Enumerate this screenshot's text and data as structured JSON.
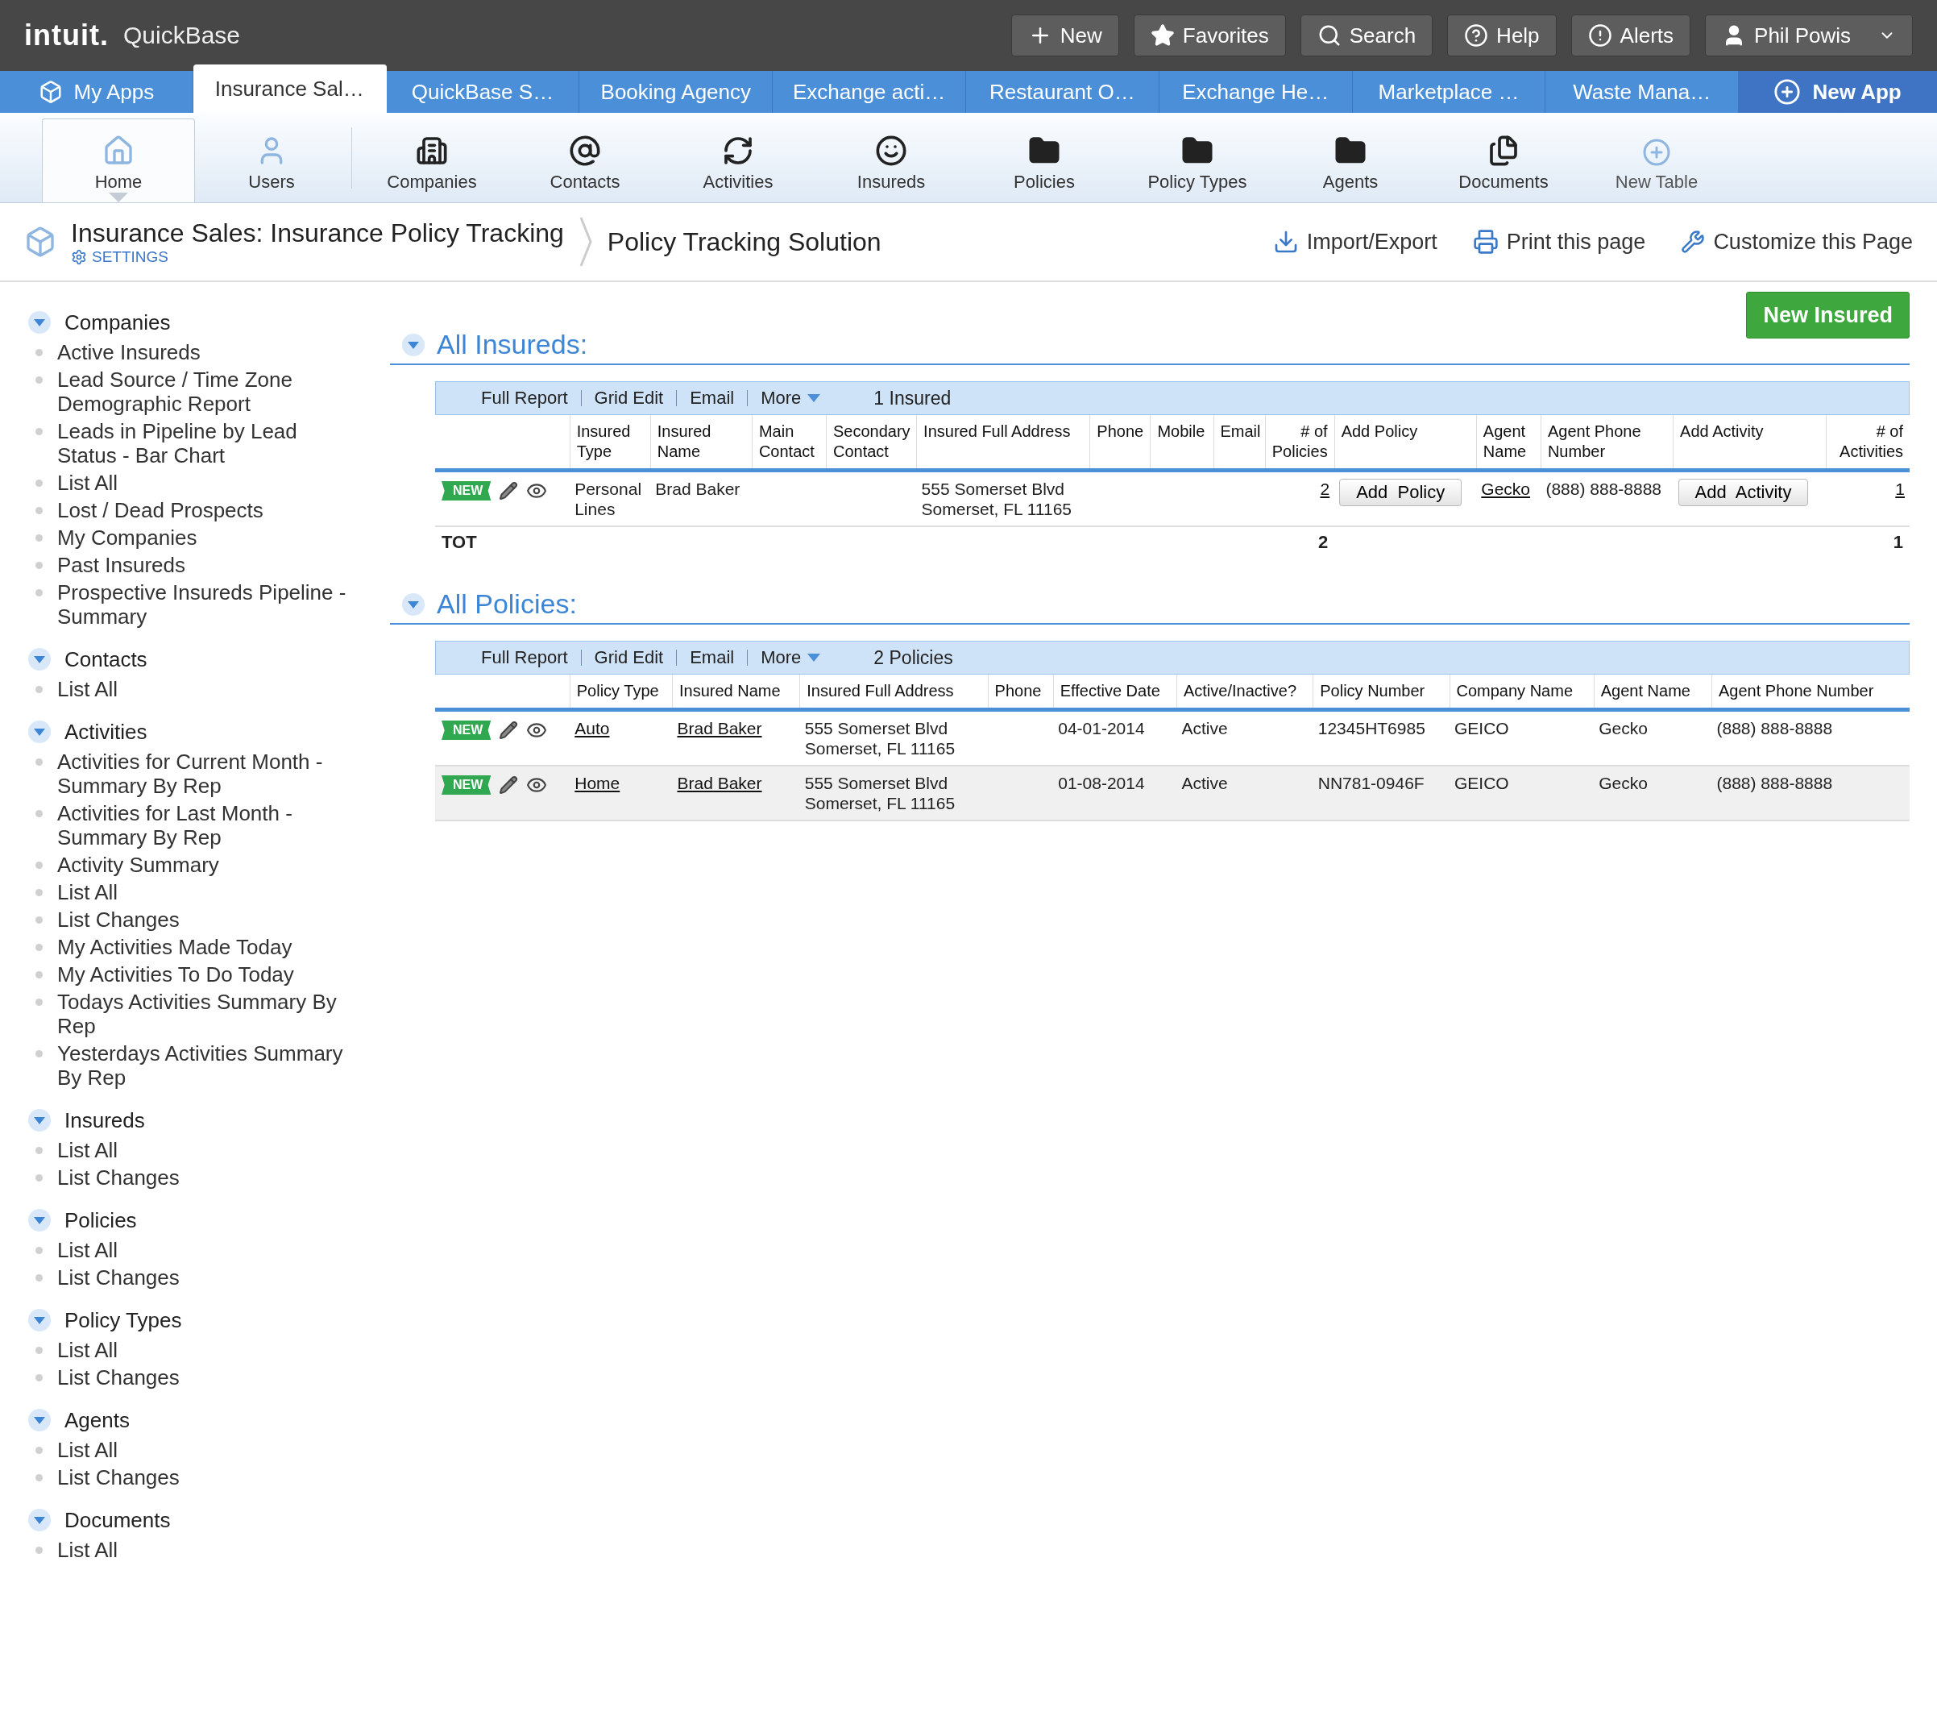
{
  "brand": {
    "logo": "intuit.",
    "product": "QuickBase"
  },
  "top_buttons": [
    {
      "label": "New",
      "kind": "new"
    },
    {
      "label": "Favorites",
      "kind": "favorites"
    },
    {
      "label": "Search",
      "kind": "search"
    },
    {
      "label": "Help",
      "kind": "help"
    },
    {
      "label": "Alerts",
      "kind": "alerts"
    },
    {
      "label": "Phil Powis",
      "kind": "user"
    }
  ],
  "app_tabs": [
    {
      "label": "My Apps",
      "kind": "home",
      "selected": false
    },
    {
      "label": "Insurance Sal…",
      "kind": "app",
      "selected": true
    },
    {
      "label": "QuickBase S…",
      "kind": "app",
      "selected": false
    },
    {
      "label": "Booking Agency",
      "kind": "app",
      "selected": false
    },
    {
      "label": "Exchange acti…",
      "kind": "app",
      "selected": false
    },
    {
      "label": "Restaurant O…",
      "kind": "app",
      "selected": false
    },
    {
      "label": "Exchange He…",
      "kind": "app",
      "selected": false
    },
    {
      "label": "Marketplace …",
      "kind": "app",
      "selected": false
    },
    {
      "label": "Waste Mana…",
      "kind": "app",
      "selected": false
    },
    {
      "label": "New App",
      "kind": "new",
      "selected": false
    }
  ],
  "toolbar": [
    {
      "label": "Home",
      "kind": "home",
      "selected": true
    },
    {
      "label": "Users",
      "kind": "users",
      "selected": false
    },
    {
      "label": "Companies",
      "kind": "companies",
      "selected": false
    },
    {
      "label": "Contacts",
      "kind": "contacts",
      "selected": false
    },
    {
      "label": "Activities",
      "kind": "activities",
      "selected": false
    },
    {
      "label": "Insureds",
      "kind": "insureds",
      "selected": false
    },
    {
      "label": "Policies",
      "kind": "folder",
      "selected": false
    },
    {
      "label": "Policy Types",
      "kind": "folder",
      "selected": false
    },
    {
      "label": "Agents",
      "kind": "folder",
      "selected": false
    },
    {
      "label": "Documents",
      "kind": "documents",
      "selected": false
    },
    {
      "label": "New Table",
      "kind": "new",
      "selected": false
    }
  ],
  "breadcrumb": {
    "app": "Insurance Sales: Insurance Policy Tracking",
    "settings": "SETTINGS",
    "page": "Policy Tracking Solution"
  },
  "page_actions": [
    {
      "label": "Import/Export",
      "kind": "import"
    },
    {
      "label": "Print this page",
      "kind": "print"
    },
    {
      "label": "Customize this Page",
      "kind": "customize"
    }
  ],
  "new_button": "New Insured",
  "sidebar": [
    {
      "title": "Companies",
      "expanded": true,
      "items": [
        "Active Insureds",
        "Lead Source / Time Zone Demographic Report",
        "Leads in Pipeline by Lead Status - Bar Chart",
        "List All",
        "Lost / Dead Prospects",
        "My Companies",
        "Past Insureds",
        "Prospective Insureds Pipeline - Summary"
      ]
    },
    {
      "title": "Contacts",
      "expanded": true,
      "items": [
        "List All"
      ]
    },
    {
      "title": "Activities",
      "expanded": true,
      "items": [
        "Activities for Current Month - Summary By Rep",
        "Activities for Last Month - Summary By Rep",
        "Activity Summary",
        "List All",
        "List Changes",
        "My Activities Made Today",
        "My Activities To Do Today",
        "Todays Activities Summary By Rep",
        "Yesterdays Activities Summary By Rep"
      ]
    },
    {
      "title": "Insureds",
      "expanded": true,
      "items": [
        "List All",
        "List Changes"
      ]
    },
    {
      "title": "Policies",
      "expanded": true,
      "items": [
        "List All",
        "List Changes"
      ]
    },
    {
      "title": "Policy Types",
      "expanded": true,
      "items": [
        "List All",
        "List Changes"
      ]
    },
    {
      "title": "Agents",
      "expanded": true,
      "items": [
        "List All",
        "List Changes"
      ]
    },
    {
      "title": "Documents",
      "expanded": true,
      "items": [
        "List All"
      ]
    }
  ],
  "reports": [
    {
      "title": "All Insureds:",
      "expanded": true,
      "actions": [
        "Full Report",
        "Grid Edit",
        "Email",
        "More"
      ],
      "count": "1 Insured",
      "columns": [
        {
          "label": "Insured Type",
          "numeric": false
        },
        {
          "label": "Insured Name",
          "numeric": false
        },
        {
          "label": "Main Contact",
          "numeric": false
        },
        {
          "label": "Secondary Contact",
          "numeric": false
        },
        {
          "label": "Insured Full Address",
          "numeric": false
        },
        {
          "label": "Phone",
          "numeric": false
        },
        {
          "label": "Mobile",
          "numeric": false
        },
        {
          "label": "Email",
          "numeric": false
        },
        {
          "label": "# of Policies",
          "numeric": true
        },
        {
          "label": "Add Policy",
          "numeric": false
        },
        {
          "label": "Agent Name",
          "numeric": false
        },
        {
          "label": "Agent Phone Number",
          "numeric": false
        },
        {
          "label": "Add Activity",
          "numeric": false
        },
        {
          "label": "# of Activities",
          "numeric": true
        }
      ],
      "rows": [
        {
          "badge": "NEW",
          "cells": [
            {
              "text": "Personal Lines",
              "kind": "text"
            },
            {
              "text": "Brad Baker",
              "kind": "text"
            },
            null,
            null,
            {
              "text": "555 Somerset Blvd\nSomerset, FL 11165",
              "kind": "text"
            },
            null,
            null,
            null,
            {
              "text": "2",
              "kind": "link"
            },
            {
              "text": "Add  Policy",
              "kind": "button"
            },
            {
              "text": "Gecko",
              "kind": "link"
            },
            {
              "text": "(888) 888-8888",
              "kind": "text"
            },
            {
              "text": "Add  Activity",
              "kind": "button"
            },
            {
              "text": "1",
              "kind": "link"
            }
          ]
        }
      ],
      "total": {
        "label": "TOT",
        "cells": [
          null,
          null,
          null,
          null,
          null,
          null,
          null,
          null,
          "2",
          null,
          null,
          null,
          null,
          "1"
        ]
      }
    },
    {
      "title": "All Policies:",
      "expanded": true,
      "actions": [
        "Full Report",
        "Grid Edit",
        "Email",
        "More"
      ],
      "count": "2 Policies",
      "columns": [
        {
          "label": "Policy Type",
          "numeric": false
        },
        {
          "label": "Insured Name",
          "numeric": false
        },
        {
          "label": "Insured Full Address",
          "numeric": false
        },
        {
          "label": "Phone",
          "numeric": false
        },
        {
          "label": "Effective Date",
          "numeric": false
        },
        {
          "label": "Active/Inactive?",
          "numeric": false
        },
        {
          "label": "Policy Number",
          "numeric": false
        },
        {
          "label": "Company Name",
          "numeric": false
        },
        {
          "label": "Agent Name",
          "numeric": false
        },
        {
          "label": "Agent Phone Number",
          "numeric": false
        }
      ],
      "rows": [
        {
          "badge": "NEW",
          "cells": [
            {
              "text": "Auto",
              "kind": "link"
            },
            {
              "text": "Brad Baker",
              "kind": "link"
            },
            {
              "text": "555 Somerset Blvd\nSomerset, FL 11165",
              "kind": "text"
            },
            null,
            {
              "text": "04-01-2014",
              "kind": "text"
            },
            {
              "text": "Active",
              "kind": "text"
            },
            {
              "text": "12345HT6985",
              "kind": "text"
            },
            {
              "text": "GEICO",
              "kind": "text"
            },
            {
              "text": "Gecko",
              "kind": "text"
            },
            {
              "text": "(888) 888-8888",
              "kind": "text"
            }
          ]
        },
        {
          "badge": "NEW",
          "cells": [
            {
              "text": "Home",
              "kind": "link"
            },
            {
              "text": "Brad Baker",
              "kind": "link"
            },
            {
              "text": "555 Somerset Blvd\nSomerset, FL 11165",
              "kind": "text"
            },
            null,
            {
              "text": "01-08-2014",
              "kind": "text"
            },
            {
              "text": "Active",
              "kind": "text"
            },
            {
              "text": "NN781-0946F",
              "kind": "text"
            },
            {
              "text": "GEICO",
              "kind": "text"
            },
            {
              "text": "Gecko",
              "kind": "text"
            },
            {
              "text": "(888) 888-8888",
              "kind": "text"
            }
          ]
        }
      ]
    }
  ]
}
